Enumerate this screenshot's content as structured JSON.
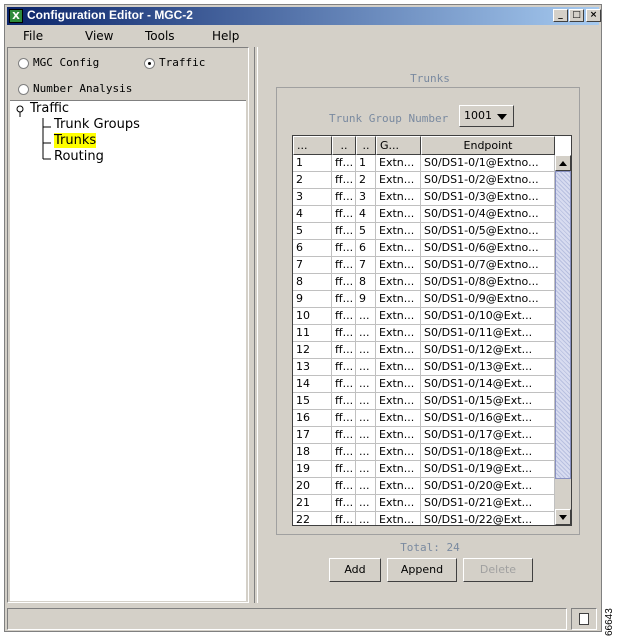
{
  "window": {
    "title": "Configuration Editor - MGC-2",
    "app_icon": "X"
  },
  "menu": [
    "File",
    "View",
    "Tools",
    "Help"
  ],
  "mode": {
    "options": [
      "MGC Config",
      "Traffic",
      "Number Analysis"
    ],
    "selected": "Traffic"
  },
  "tree": {
    "root": "Traffic",
    "children": [
      "Trunk Groups",
      "Trunks",
      "Routing"
    ],
    "selected": "Trunks"
  },
  "panel": {
    "title": "Trunks",
    "trunk_group_label": "Trunk Group Number",
    "trunk_group_value": "1001",
    "total_label": "Total: 24"
  },
  "table": {
    "headers": [
      "...",
      "..",
      "..",
      "G...",
      "Endpoint"
    ],
    "rows": [
      [
        "1",
        "ff...",
        "1",
        "Extn...",
        "S0/DS1-0/1@Extno..."
      ],
      [
        "2",
        "ff...",
        "2",
        "Extn...",
        "S0/DS1-0/2@Extno..."
      ],
      [
        "3",
        "ff...",
        "3",
        "Extn...",
        "S0/DS1-0/3@Extno..."
      ],
      [
        "4",
        "ff...",
        "4",
        "Extn...",
        "S0/DS1-0/4@Extno..."
      ],
      [
        "5",
        "ff...",
        "5",
        "Extn...",
        "S0/DS1-0/5@Extno..."
      ],
      [
        "6",
        "ff...",
        "6",
        "Extn...",
        "S0/DS1-0/6@Extno..."
      ],
      [
        "7",
        "ff...",
        "7",
        "Extn...",
        "S0/DS1-0/7@Extno..."
      ],
      [
        "8",
        "ff...",
        "8",
        "Extn...",
        "S0/DS1-0/8@Extno..."
      ],
      [
        "9",
        "ff...",
        "9",
        "Extn...",
        "S0/DS1-0/9@Extno..."
      ],
      [
        "10",
        "ff...",
        "...",
        "Extn...",
        "S0/DS1-0/10@Ext..."
      ],
      [
        "11",
        "ff...",
        "...",
        "Extn...",
        "S0/DS1-0/11@Ext..."
      ],
      [
        "12",
        "ff...",
        "...",
        "Extn...",
        "S0/DS1-0/12@Ext..."
      ],
      [
        "13",
        "ff...",
        "...",
        "Extn...",
        "S0/DS1-0/13@Ext..."
      ],
      [
        "14",
        "ff...",
        "...",
        "Extn...",
        "S0/DS1-0/14@Ext..."
      ],
      [
        "15",
        "ff...",
        "...",
        "Extn...",
        "S0/DS1-0/15@Ext..."
      ],
      [
        "16",
        "ff...",
        "...",
        "Extn...",
        "S0/DS1-0/16@Ext..."
      ],
      [
        "17",
        "ff...",
        "...",
        "Extn...",
        "S0/DS1-0/17@Ext..."
      ],
      [
        "18",
        "ff...",
        "...",
        "Extn...",
        "S0/DS1-0/18@Ext..."
      ],
      [
        "19",
        "ff...",
        "...",
        "Extn...",
        "S0/DS1-0/19@Ext..."
      ],
      [
        "20",
        "ff...",
        "...",
        "Extn...",
        "S0/DS1-0/20@Ext..."
      ],
      [
        "21",
        "ff...",
        "...",
        "Extn...",
        "S0/DS1-0/21@Ext..."
      ],
      [
        "22",
        "ff...",
        "...",
        "Extn...",
        "S0/DS1-0/22@Ext..."
      ]
    ]
  },
  "buttons": {
    "add": "Add",
    "append": "Append",
    "delete": "Delete"
  },
  "side_code": "66643",
  "colors": {
    "title_start": "#0a246a",
    "title_end": "#a6caf0",
    "highlight": "#ffff00",
    "caption": "#7a8aa0"
  }
}
